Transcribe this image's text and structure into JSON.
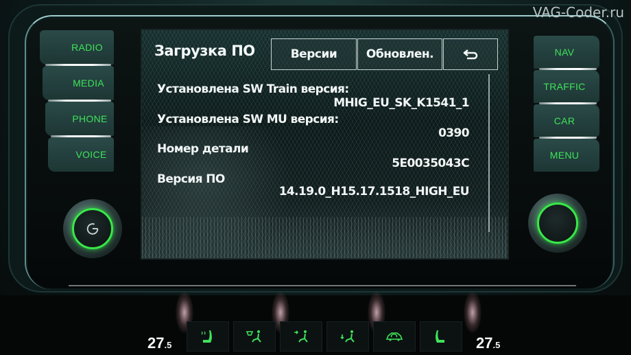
{
  "watermark": "VAG-Coder.ru",
  "left_buttons": [
    {
      "label": "RADIO"
    },
    {
      "label": "MEDIA"
    },
    {
      "label": "PHONE"
    },
    {
      "label": "VOICE"
    }
  ],
  "right_buttons": [
    {
      "label": "NAV"
    },
    {
      "label": "TRAFFIC"
    },
    {
      "label": "CAR"
    },
    {
      "label": "MENU"
    }
  ],
  "knobs": {
    "left_icon": "power-icon",
    "right_icon": "none"
  },
  "screen": {
    "title": "Загрузка ПО",
    "tabs": [
      {
        "label": "Версии",
        "selected": true
      },
      {
        "label": "Обновлен.",
        "selected": false
      }
    ],
    "back_icon": "back-arrow-icon",
    "rows": [
      {
        "label": "Установлена SW Train версия:",
        "value": "MHIG_EU_SK_K1541_1"
      },
      {
        "label": "Установлена SW MU версия:",
        "value": "0390"
      },
      {
        "label": "Номер детали",
        "value": "5E0035043C"
      },
      {
        "label": "Версия ПО",
        "value": "14.19.0_H15.17.1518_HIGH_EU"
      }
    ]
  },
  "climate": {
    "temp_left": "27",
    "temp_left_decimal": ".5",
    "temp_right": "27",
    "temp_right_decimal": ".5",
    "buttons": [
      {
        "icon": "seat-heat-left-icon"
      },
      {
        "icon": "windshield-defrost-airflow-icon"
      },
      {
        "icon": "airflow-upper-icon"
      },
      {
        "icon": "airflow-lower-icon"
      },
      {
        "icon": "recirculation-car-icon"
      },
      {
        "icon": "seat-heat-right-icon"
      }
    ],
    "accent_color": "#3fe35b"
  }
}
